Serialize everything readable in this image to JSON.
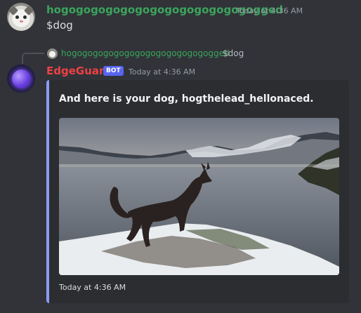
{
  "message1": {
    "username": "hogogogogogogogogogogogogogogged",
    "timestamp": "Today at 4:36 AM",
    "content": "$dog",
    "username_color": "#3ba55c"
  },
  "reply": {
    "username": "hogogogogogogogogogogogogogogged",
    "content": "$dog"
  },
  "message2": {
    "username": "EdgeGuard",
    "badge": "BOT",
    "timestamp": "Today at 4:36 AM",
    "username_color": "#ed4245",
    "embed": {
      "description": "And here is your dog, hogthelead_hellonaced.",
      "footer": "Today at 4:36 AM",
      "accent_color": "#8b9af5",
      "image_subject": "dark dog standing on snowy shore by a lake with mountains"
    }
  },
  "colors": {
    "background": "#313338",
    "embed_background": "#2b2d31",
    "badge": "#5865f2"
  }
}
